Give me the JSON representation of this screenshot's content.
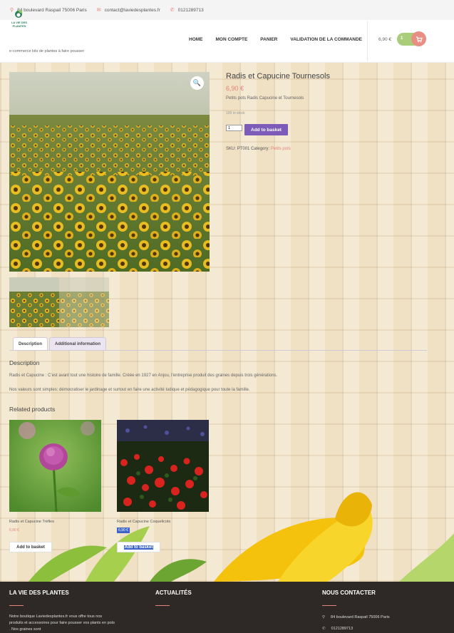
{
  "topbar": {
    "address": "84 boulevard Raspail 75006 Paris",
    "email": "contact@laviedesplantes.fr",
    "phone": "0121289713"
  },
  "brand": {
    "logo_text": "LA VIE DES PLANTES",
    "tagline": "e-commerce kits de plantes à faire pousser"
  },
  "nav": {
    "items": [
      "HOME",
      "MON COMPTE",
      "PANIER",
      "VALIDATION DE LA COMMANDE"
    ]
  },
  "cart": {
    "total": "6,90 €",
    "count": "1"
  },
  "product": {
    "title": "Radis et Capucine Tournesols",
    "price": "6,90 €",
    "short_description": "Petits pots Radis Capucine et Tournesols",
    "stock": "100 in stock",
    "quantity": "1",
    "add_label": "Add to basket",
    "sku_label": "SKU:",
    "sku": "PT001",
    "category_label": "Category:",
    "category": "Petits pots"
  },
  "tabs": [
    {
      "label": "Description",
      "active": true
    },
    {
      "label": "Additional information",
      "active": false
    }
  ],
  "description": {
    "heading": "Description",
    "p1": "Radis et Capucine : C’est avant tout une histoire de famille. Créée en 1927 en Anjou, l’entreprise produit des graines depuis trois générations.",
    "p2": "Nos valeurs sont simples: démocratiser le jardinage et surtout en faire une activité ludique et pédagogique pour toute la famille."
  },
  "related": {
    "heading": "Related products",
    "items": [
      {
        "name": "Radis et Capucine Trèfles",
        "price": "6,90 €",
        "button": "Add to basket"
      },
      {
        "name": "Radis et Capucine Coquelicots",
        "price": "6,90 €",
        "button": "Add to basket"
      }
    ]
  },
  "footer": {
    "col1_title": "LA VIE DES PLANTES",
    "col1_text": "Notre boutique Laviedesplantes.fr vous offre tous nos produits et accessoires pour faire pousser vos plants en pots . Nos graines sont",
    "col2_title": "ACTUALITÉS",
    "col3_title": "NOUS CONTACTER",
    "address": "84 boulevard Raspail 75006 Paris",
    "phone": "0121289713"
  },
  "colors": {
    "accent": "#e5837a",
    "button_purple": "#7c5cb8",
    "cart_green": "#a9cd7a",
    "footer_bg": "#2e2927"
  },
  "icons": [
    "location-icon",
    "mail-icon",
    "phone-icon",
    "cart-icon",
    "search-zoom-icon"
  ]
}
